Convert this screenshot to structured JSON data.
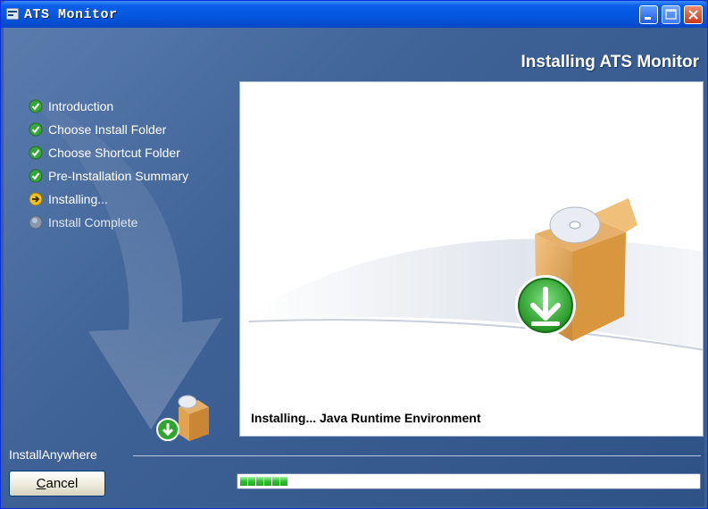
{
  "window": {
    "title": "ATS Monitor"
  },
  "header": {
    "title": "Installing ATS Monitor"
  },
  "steps": [
    {
      "label": "Introduction",
      "state": "done",
      "icon": "check-circle-icon"
    },
    {
      "label": "Choose Install Folder",
      "state": "done",
      "icon": "check-circle-icon"
    },
    {
      "label": "Choose Shortcut Folder",
      "state": "done",
      "icon": "check-circle-icon"
    },
    {
      "label": "Pre-Installation Summary",
      "state": "done",
      "icon": "check-circle-icon"
    },
    {
      "label": "Installing...",
      "state": "current",
      "icon": "arrow-right-circle-icon"
    },
    {
      "label": "Install Complete",
      "state": "pending",
      "icon": "empty-circle-icon"
    }
  ],
  "content": {
    "status": "Installing... Java Runtime Environment"
  },
  "footer": {
    "brand": "InstallAnywhere",
    "cancel_label": "Cancel",
    "progress_fraction": 0.11
  },
  "colors": {
    "done": "#3aa63a",
    "current": "#f2c21b",
    "pending": "#9aa6b8",
    "progress": "#2fbf2f"
  }
}
